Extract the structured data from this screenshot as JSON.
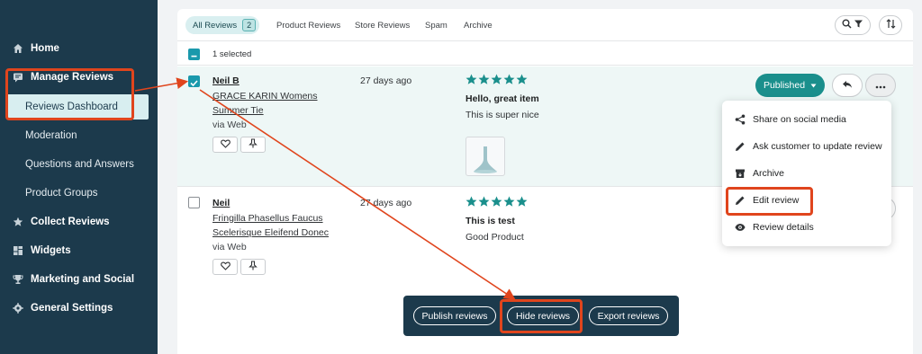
{
  "sidebar": {
    "items": [
      {
        "label": "Home",
        "icon": "home-icon"
      },
      {
        "label": "Manage Reviews",
        "icon": "chat-icon"
      },
      {
        "label": "Reviews Dashboard"
      },
      {
        "label": "Moderation"
      },
      {
        "label": "Questions and Answers"
      },
      {
        "label": "Product Groups"
      },
      {
        "label": "Collect Reviews",
        "icon": "star-icon"
      },
      {
        "label": "Widgets",
        "icon": "widgets-icon"
      },
      {
        "label": "Marketing and Social",
        "icon": "trophy-icon"
      },
      {
        "label": "General Settings",
        "icon": "gear-icon"
      }
    ]
  },
  "tabs": {
    "all_label": "All Reviews",
    "all_count": "2",
    "items": [
      "Product Reviews",
      "Store Reviews",
      "Spam",
      "Archive"
    ]
  },
  "selection": {
    "text": "1 selected"
  },
  "reviews": [
    {
      "author": "Neil B",
      "product": "GRACE KARIN Womens Summer Tie",
      "source": "via Web",
      "date": "27 days ago",
      "rating": 5,
      "title": "Hello, great item",
      "body": "This is super nice",
      "status": "Published"
    },
    {
      "author": "Neil",
      "product": "Fringilla Phasellus Faucus Scelerisque Eleifend Donec",
      "source": "via Web",
      "date": "27 days ago",
      "rating": 5,
      "title": "This is test",
      "body": "Good Product"
    }
  ],
  "menu": {
    "items": [
      {
        "label": "Share on social media",
        "icon": "share-icon"
      },
      {
        "label": "Ask customer to update review",
        "icon": "pencil-icon"
      },
      {
        "label": "Archive",
        "icon": "archive-icon"
      },
      {
        "label": "Edit review",
        "icon": "pencil-icon"
      },
      {
        "label": "Review details",
        "icon": "eye-icon"
      }
    ]
  },
  "bulk": {
    "publish": "Publish reviews",
    "hide": "Hide reviews",
    "export": "Export reviews"
  },
  "colors": {
    "sidebar": "#1c3a4c",
    "accent": "#1a8f8c",
    "highlight": "#e0451d",
    "star": "#1a8f8c"
  }
}
